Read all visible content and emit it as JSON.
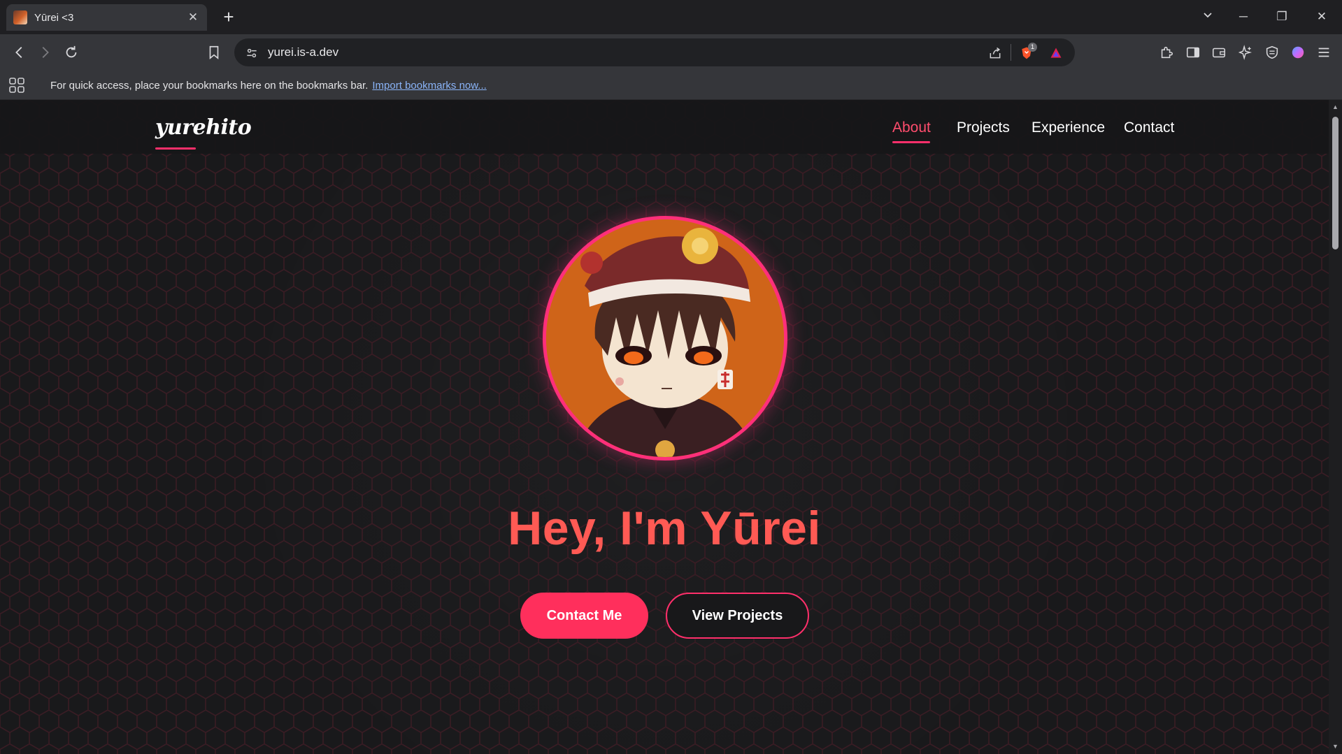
{
  "browser": {
    "tab": {
      "title": "Yūrei <3",
      "close": "✕"
    },
    "new_tab": "+",
    "window": {
      "list": "⌄",
      "minimize": "─",
      "restore": "❐",
      "close": "✕"
    },
    "address": {
      "url": "yurei.is-a.dev"
    },
    "icons": [
      "back-icon",
      "forward-icon",
      "reload-icon",
      "bookmark-icon",
      "site-settings-icon",
      "share-icon",
      "brave-shields-icon",
      "brave-rewards-icon",
      "extensions-icon",
      "sidebar-icon",
      "wallet-icon",
      "leo-ai-icon",
      "vpn-icon",
      "profile-icon",
      "menu-icon"
    ],
    "shields_badge": "1",
    "bookmarks_bar": {
      "message": "For quick access, place your bookmarks here on the bookmarks bar.",
      "link": "Import bookmarks now..."
    }
  },
  "site": {
    "logo": "yurehito",
    "nav": [
      {
        "label": "About",
        "active": true
      },
      {
        "label": "Projects",
        "active": false
      },
      {
        "label": "Experience",
        "active": false
      },
      {
        "label": "Contact",
        "active": false
      }
    ],
    "hero": {
      "title": "Hey, I'm Yūrei",
      "primary_button": "Contact Me",
      "secondary_button": "View Projects"
    }
  },
  "colors": {
    "accent": "#ff2f6b",
    "title": "#ff5a54",
    "background": "#19191b"
  }
}
